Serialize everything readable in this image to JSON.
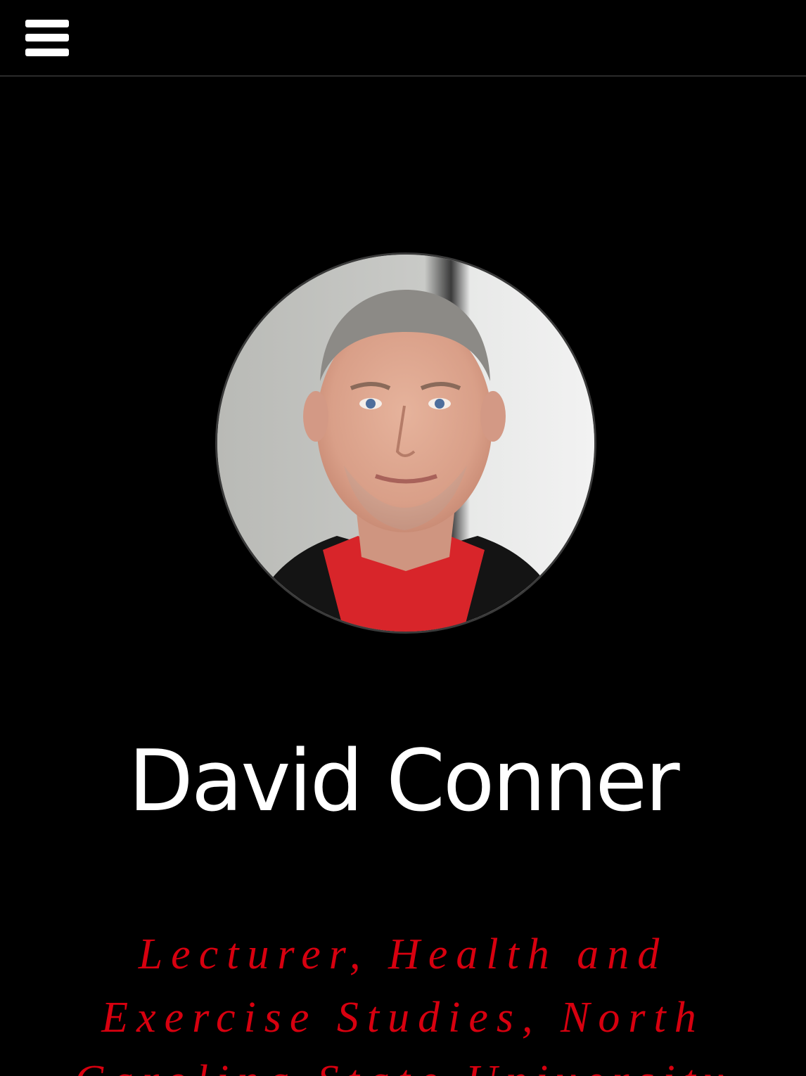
{
  "header": {
    "menu_icon": "hamburger-menu-icon"
  },
  "profile": {
    "photo_description_icon": "portrait-photo",
    "name": "David Conner",
    "title": "Lecturer, Health and Exercise Studies, North Carolina State University"
  },
  "colors": {
    "background": "#000000",
    "name_text": "#ffffff",
    "title_text": "#d7000f"
  }
}
